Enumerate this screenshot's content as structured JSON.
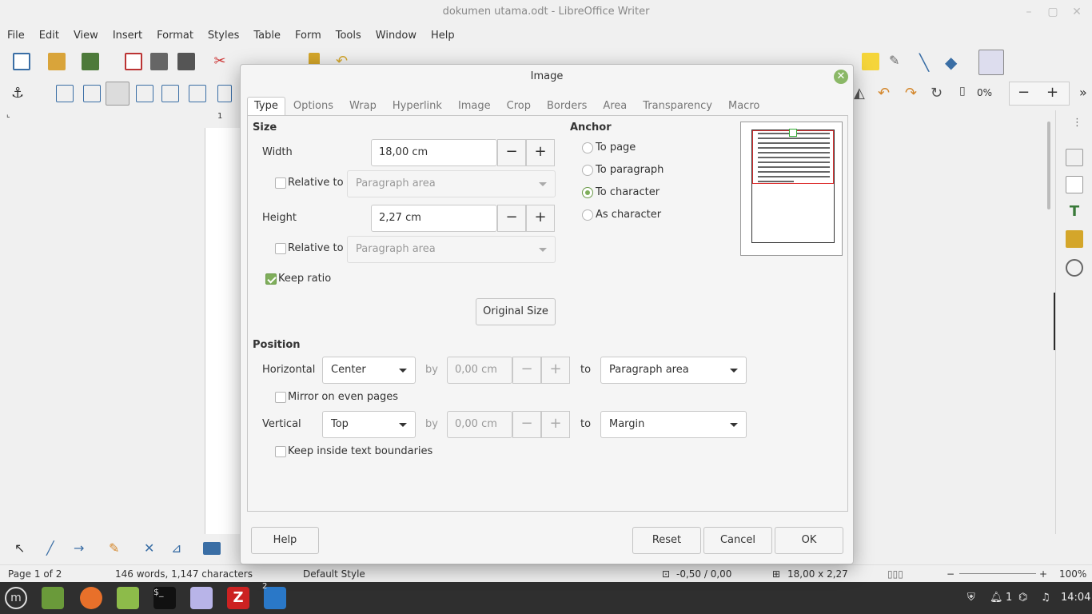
{
  "window": {
    "title": "dokumen utama.odt - LibreOffice Writer"
  },
  "menubar": {
    "items": [
      "File",
      "Edit",
      "View",
      "Insert",
      "Format",
      "Styles",
      "Table",
      "Form",
      "Tools",
      "Window",
      "Help"
    ]
  },
  "toolbar2": {
    "zoom_text": "0%",
    "minus": "−",
    "plus": "+",
    "ruler_mark": "1"
  },
  "dialog": {
    "title": "Image",
    "tabs": [
      "Type",
      "Options",
      "Wrap",
      "Hyperlink",
      "Image",
      "Crop",
      "Borders",
      "Area",
      "Transparency",
      "Macro"
    ],
    "size": {
      "heading": "Size",
      "width_label": "Width",
      "width_value": "18,00 cm",
      "relative_label": "Relative to",
      "relative_option": "Paragraph area",
      "height_label": "Height",
      "height_value": "2,27 cm",
      "keep_ratio_label": "Keep ratio",
      "keep_ratio_checked": true,
      "original_size_label": "Original Size"
    },
    "anchor": {
      "heading": "Anchor",
      "options": [
        "To page",
        "To paragraph",
        "To character",
        "As character"
      ],
      "selected": "To character"
    },
    "position": {
      "heading": "Position",
      "horizontal_label": "Horizontal",
      "horizontal_value": "Center",
      "by_label": "by",
      "horizontal_by": "0,00 cm",
      "to_label": "to",
      "horizontal_to": "Paragraph area",
      "mirror_label": "Mirror on even pages",
      "vertical_label": "Vertical",
      "vertical_value": "Top",
      "vertical_by": "0,00 cm",
      "vertical_to": "Margin",
      "keep_inside_label": "Keep inside text boundaries"
    },
    "buttons": {
      "help": "Help",
      "reset": "Reset",
      "cancel": "Cancel",
      "ok": "OK"
    },
    "spin_minus": "−",
    "spin_plus": "+"
  },
  "statusbar": {
    "page": "Page 1 of 2",
    "words": "146 words, 1,147 characters",
    "style": "Default Style",
    "position": "-0,50 / 0,00",
    "size": "18,00 x 2,27",
    "zoom": "100%"
  },
  "taskbar": {
    "time": "14:04",
    "workspace": "1",
    "badge": "2"
  },
  "colors": {
    "accent": "#7fae5b",
    "close": "#8bb867",
    "taskbar": "#2f2f2f"
  }
}
